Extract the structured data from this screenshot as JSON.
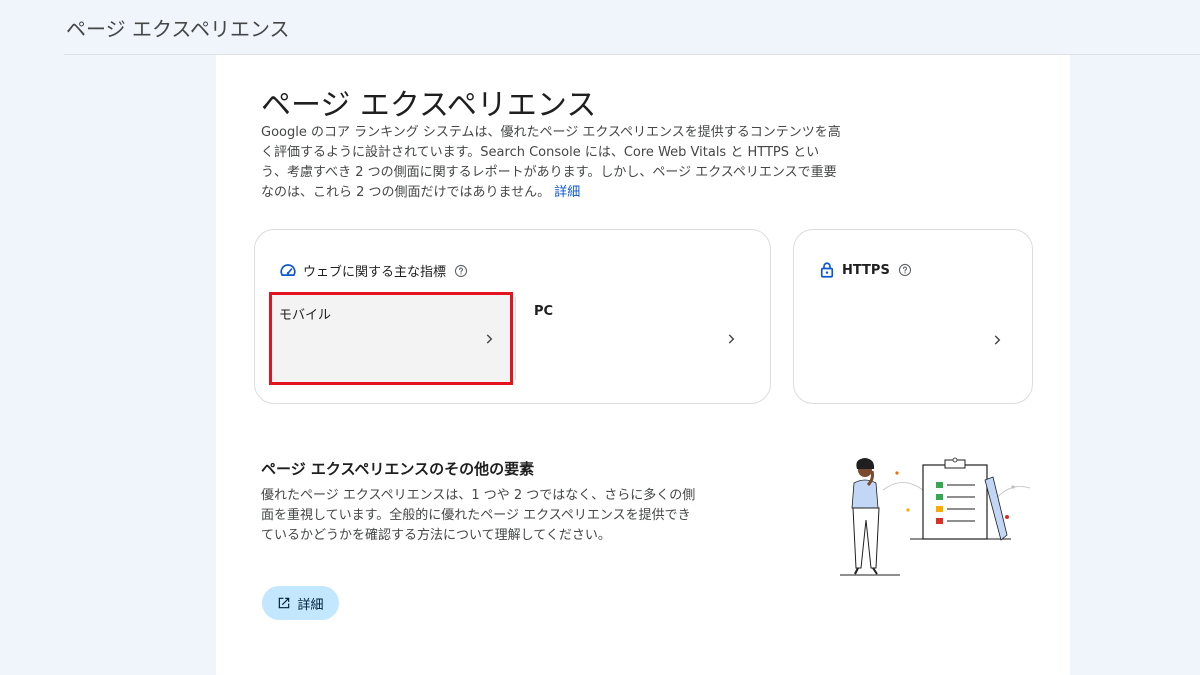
{
  "topbar": {
    "title": "ページ エクスペリエンス"
  },
  "main": {
    "title": "ページ エクスペリエンス",
    "description": "Google のコア ランキング システムは、優れたページ エクスペリエンスを提供するコンテンツを高く評価するように設計されています。Search Console には、Core Web Vitals と HTTPS という、考慮すべき 2 つの側面に関するレポートがあります。しかし、ページ エクスペリエンスで重要なのは、これら 2 つの側面だけではありません。",
    "learn_more": "詳細"
  },
  "cwv_card": {
    "title": "ウェブに関する主な指標",
    "icon": "speed-gauge-icon",
    "tiles": [
      {
        "label": "モバイル"
      },
      {
        "label": "PC"
      }
    ]
  },
  "https_card": {
    "title": "HTTPS",
    "icon": "lock-icon"
  },
  "other": {
    "title": "ページ エクスペリエンスのその他の要素",
    "description": "優れたページ エクスペリエンスは、1 つや 2 つではなく、さらに多くの側面を重視しています。全般的に優れたページ エクスペリエンスを提供できているかどうかを確認する方法について理解してください。",
    "button_label": "詳細",
    "button_icon": "open-in-new-icon"
  },
  "colors": {
    "accent": "#0b57d0",
    "highlight": "#e3141f",
    "button_bg": "#c2e7ff",
    "page_bg": "#f0f4fb"
  }
}
